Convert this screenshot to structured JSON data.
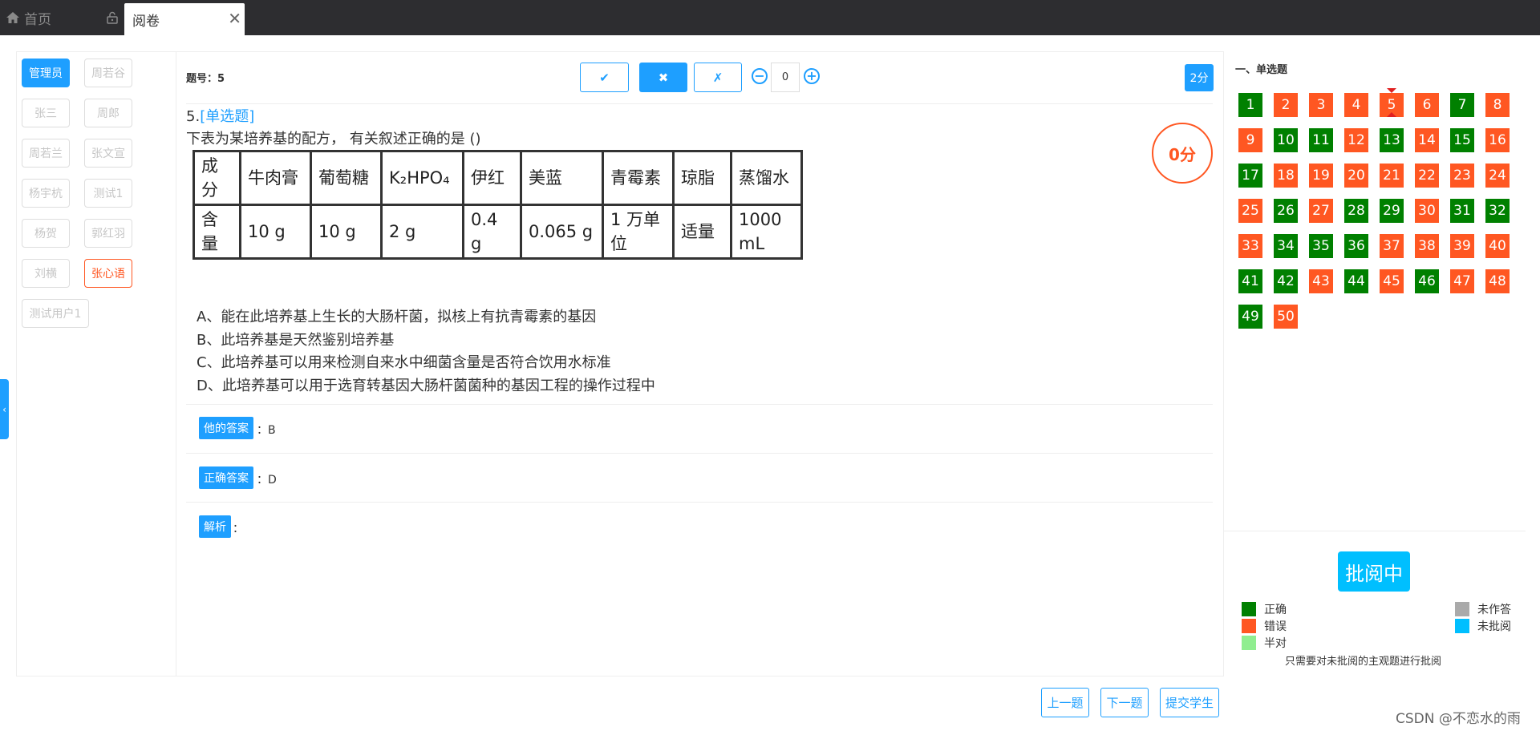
{
  "tabs": {
    "home": "首页",
    "active": "阅卷",
    "close": "✕"
  },
  "users": [
    {
      "label": "管理员"
    },
    {
      "label": "周若谷"
    },
    {
      "label": "张三"
    },
    {
      "label": "周郎"
    },
    {
      "label": "周若兰"
    },
    {
      "label": "张文宣"
    },
    {
      "label": "杨宇杭"
    },
    {
      "label": "测试1"
    },
    {
      "label": "杨贺"
    },
    {
      "label": "郭红羽"
    },
    {
      "label": "刘横"
    },
    {
      "label": "张心语"
    },
    {
      "label": "测试用户1"
    }
  ],
  "toolbar": {
    "qnum_label": "题号：5",
    "right_icon": "✔",
    "wrong_icon": "✖",
    "half_icon": "✗",
    "minus": "−",
    "plus": "+",
    "score_value": "0",
    "score_badge": "2分"
  },
  "question": {
    "num": "5.",
    "type": "[单选题]",
    "text": "下表为某培养基的配方， 有关叙述正确的是 ()",
    "score": "0分",
    "table": {
      "row1": [
        "成分",
        "牛肉膏",
        "葡萄糖",
        "K₂HPO₄",
        "伊红",
        "美蓝",
        "青霉素",
        "琼脂",
        "蒸馏水"
      ],
      "row2": [
        "含量",
        "10 g",
        "10 g",
        "2 g",
        "0.4 g",
        "0.065 g",
        "1 万单位",
        "适量",
        "1000 mL"
      ]
    },
    "options": [
      "A、能在此培养基上生长的大肠杆菌，拟核上有抗青霉素的基因",
      "B、此培养基是天然鉴别培养基",
      "C、此培养基可以用来检测自来水中细菌含量是否符合饮用水标准",
      "D、此培养基可以用于选育转基因大肠杆菌菌种的基因工程的操作过程中"
    ],
    "his_answer_label": "他的答案",
    "his_answer": "：B",
    "correct_answer_label": "正确答案",
    "correct_answer": "：D",
    "analysis_label": "解析",
    "analysis": "："
  },
  "sheet": {
    "section_title": "一、单选题",
    "questions": [
      {
        "n": "1",
        "s": "ok"
      },
      {
        "n": "2",
        "s": "bad"
      },
      {
        "n": "3",
        "s": "bad"
      },
      {
        "n": "4",
        "s": "bad"
      },
      {
        "n": "5",
        "s": "bad"
      },
      {
        "n": "6",
        "s": "bad"
      },
      {
        "n": "7",
        "s": "ok"
      },
      {
        "n": "8",
        "s": "bad"
      },
      {
        "n": "9",
        "s": "bad"
      },
      {
        "n": "10",
        "s": "ok"
      },
      {
        "n": "11",
        "s": "ok"
      },
      {
        "n": "12",
        "s": "bad"
      },
      {
        "n": "13",
        "s": "ok"
      },
      {
        "n": "14",
        "s": "bad"
      },
      {
        "n": "15",
        "s": "ok"
      },
      {
        "n": "16",
        "s": "bad"
      },
      {
        "n": "17",
        "s": "ok"
      },
      {
        "n": "18",
        "s": "bad"
      },
      {
        "n": "19",
        "s": "bad"
      },
      {
        "n": "20",
        "s": "bad"
      },
      {
        "n": "21",
        "s": "bad"
      },
      {
        "n": "22",
        "s": "bad"
      },
      {
        "n": "23",
        "s": "bad"
      },
      {
        "n": "24",
        "s": "bad"
      },
      {
        "n": "25",
        "s": "bad"
      },
      {
        "n": "26",
        "s": "ok"
      },
      {
        "n": "27",
        "s": "bad"
      },
      {
        "n": "28",
        "s": "ok"
      },
      {
        "n": "29",
        "s": "ok"
      },
      {
        "n": "30",
        "s": "bad"
      },
      {
        "n": "31",
        "s": "ok"
      },
      {
        "n": "32",
        "s": "ok"
      },
      {
        "n": "33",
        "s": "bad"
      },
      {
        "n": "34",
        "s": "ok"
      },
      {
        "n": "35",
        "s": "ok"
      },
      {
        "n": "36",
        "s": "ok"
      },
      {
        "n": "37",
        "s": "bad"
      },
      {
        "n": "38",
        "s": "bad"
      },
      {
        "n": "39",
        "s": "bad"
      },
      {
        "n": "40",
        "s": "bad"
      },
      {
        "n": "41",
        "s": "ok"
      },
      {
        "n": "42",
        "s": "ok"
      },
      {
        "n": "43",
        "s": "bad"
      },
      {
        "n": "44",
        "s": "ok"
      },
      {
        "n": "45",
        "s": "bad"
      },
      {
        "n": "46",
        "s": "ok"
      },
      {
        "n": "47",
        "s": "bad"
      },
      {
        "n": "48",
        "s": "bad"
      },
      {
        "n": "49",
        "s": "ok"
      },
      {
        "n": "50",
        "s": "bad"
      }
    ],
    "current": "5",
    "status": "批阅中",
    "legend": {
      "correct": "正确",
      "wrong": "错误",
      "half": "半对",
      "unanswered": "未作答",
      "unreviewed": "未批阅"
    },
    "note": "只需要对未批阅的主观题进行批阅"
  },
  "colors": {
    "accent": "#1e9fff",
    "correct": "#008000",
    "wrong": "#ff5722",
    "half": "#90ee90",
    "unanswered": "#aaaaaa",
    "unreviewed": "#00bfff"
  },
  "nav": {
    "prev": "上一题",
    "next": "下一题",
    "submit": "提交学生"
  },
  "watermark": "CSDN @不恋水的雨"
}
